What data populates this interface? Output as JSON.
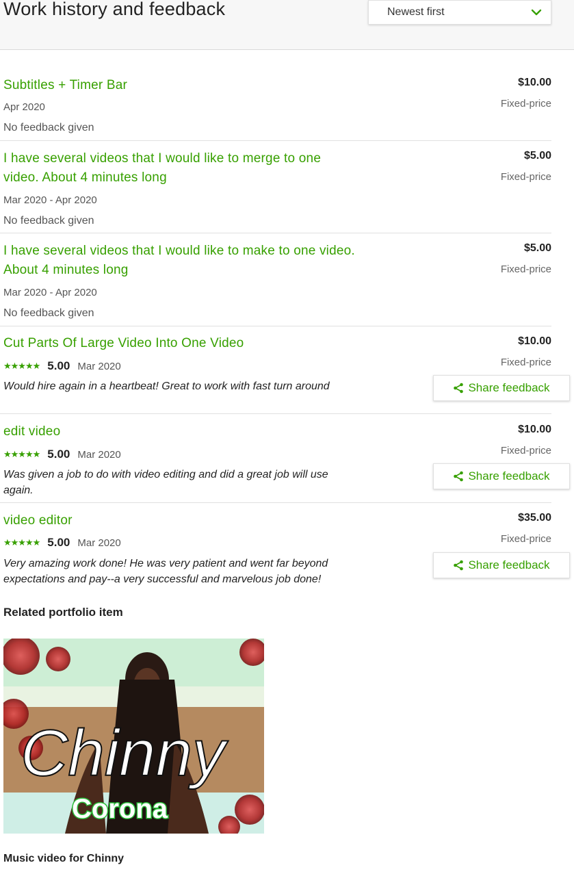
{
  "header": {
    "title": "Work history and feedback",
    "sort_value": "Newest first"
  },
  "jobs": [
    {
      "title_lines": [
        "Subtitles + Timer Bar"
      ],
      "amount": "$10.00",
      "type": "Fixed-price",
      "date": "Apr 2020",
      "feedback": "No feedback given"
    },
    {
      "title_lines": [
        "I have several videos that I would like to merge to one",
        "video. About 4 minutes long"
      ],
      "amount": "$5.00",
      "type": "Fixed-price",
      "date": "Mar 2020 - Apr 2020",
      "feedback": "No feedback given"
    },
    {
      "title_lines": [
        "I have several videos that I would like to make to one video.",
        "About 4 minutes long"
      ],
      "amount": "$5.00",
      "type": "Fixed-price",
      "date": "Mar 2020 - Apr 2020",
      "feedback": "No feedback given"
    },
    {
      "title_lines": [
        "Cut Parts Of Large Video Into One Video"
      ],
      "amount": "$10.00",
      "type": "Fixed-price",
      "stars": "★★★★★",
      "score": "5.00",
      "rating_fraction": 1.0,
      "date": "Mar 2020",
      "comment_lines": [
        "Would hire again in a heartbeat! Great to work with fast turn around"
      ],
      "share_label": "Share feedback"
    },
    {
      "title_lines": [
        "edit video"
      ],
      "amount": "$10.00",
      "type": "Fixed-price",
      "stars": "★★★★★",
      "score": "5.00",
      "rating_fraction": 1.0,
      "date": "Mar 2020",
      "comment_lines": [
        "Was given a job to do with video editing and did a great job will use",
        "again."
      ],
      "share_label": "Share feedback"
    },
    {
      "title_lines": [
        "video editor"
      ],
      "amount": "$35.00",
      "type": "Fixed-price",
      "stars": "★★★★★",
      "score": "5.00",
      "rating_fraction": 1.0,
      "date": "Mar 2020",
      "comment_lines": [
        "Very amazing work done! He was very patient and went far beyond",
        "expectations and pay--a very successful and marvelous job done!"
      ],
      "share_label": "Share feedback"
    }
  ],
  "related": {
    "title": "Related portfolio item",
    "image_text_main": "Chinny",
    "image_text_sub": "Corona",
    "caption": "Music video for Chinny"
  },
  "colors": {
    "accent": "#37a000",
    "text": "#222222",
    "muted": "#656565"
  },
  "icons": {
    "sort": "chevron-down-icon",
    "share": "share-icon",
    "star": "star-icon"
  }
}
